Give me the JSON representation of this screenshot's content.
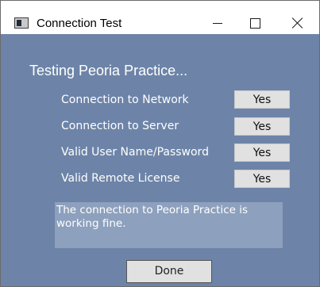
{
  "window": {
    "title": "Connection Test",
    "icons": {
      "app": "app-window-icon",
      "minimize": "minimize-icon",
      "maximize": "maximize-icon",
      "close": "close-icon"
    }
  },
  "main": {
    "heading": "Testing Peoria Practice...",
    "checks": [
      {
        "label": "Connection to Network",
        "value": "Yes"
      },
      {
        "label": "Connection to Server",
        "value": "Yes"
      },
      {
        "label": "Valid User Name/Password",
        "value": "Yes"
      },
      {
        "label": "Valid Remote License",
        "value": "Yes"
      }
    ],
    "message": "The connection to Peoria Practice is working fine.",
    "done_label": "Done"
  },
  "colors": {
    "dialog_background": "#6d84a8",
    "message_background": "#8da0bd",
    "value_box": "#e1e1e1"
  }
}
